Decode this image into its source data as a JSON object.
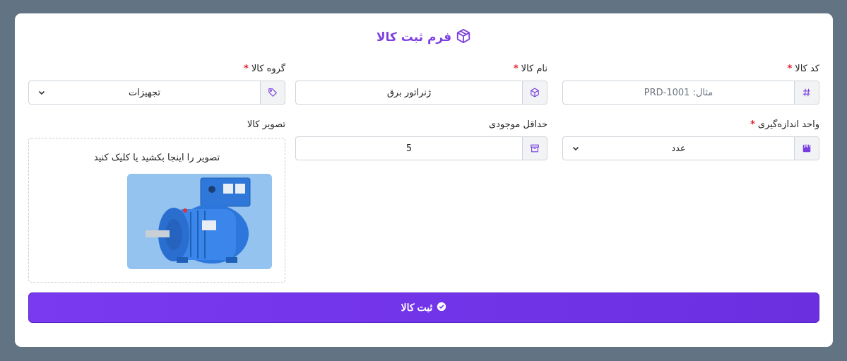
{
  "form": {
    "title": "فرم ثبت کالا",
    "title_icon": "box-icon",
    "required_mark": "*"
  },
  "fields": {
    "code": {
      "label": "کد کالا",
      "placeholder": "مثال: PRD-1001",
      "icon": "hash-icon"
    },
    "name": {
      "label": "نام کالا",
      "value": "ژنراتور برق",
      "icon": "box-icon"
    },
    "group": {
      "label": "گروه کالا",
      "value": "تجهیزات",
      "icon": "tag-icon"
    },
    "unit": {
      "label": "واحد اندازه‌گیری",
      "value": "عدد",
      "icon": "ruler-icon"
    },
    "min_stock": {
      "label": "حداقل موجودی",
      "value": "5",
      "icon": "archive-icon"
    },
    "image": {
      "label": "تصویر کالا",
      "drop_text": "تصویر را اینجا بکشید یا کلیک کنید"
    }
  },
  "submit": {
    "label": "ثبت کالا",
    "icon": "check-circle-icon"
  },
  "colors": {
    "accent": "#7a3af0",
    "required": "#e0242b",
    "background": "#627383"
  }
}
